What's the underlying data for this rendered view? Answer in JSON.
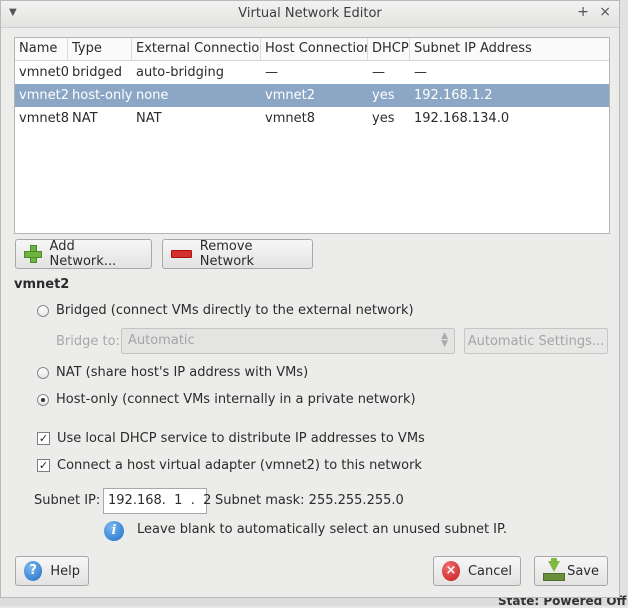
{
  "window": {
    "title": "Virtual Network Editor",
    "plus_glyph": "+",
    "close_glyph": "×",
    "menu_glyph": "▼"
  },
  "table": {
    "headers": [
      "Name",
      "Type",
      "External Connection",
      "Host Connection",
      "DHCP",
      "Subnet IP Address"
    ],
    "rows": [
      [
        "vmnet0",
        "bridged",
        "auto-bridging",
        "—",
        "—",
        "—"
      ],
      [
        "vmnet2",
        "host-only",
        "none",
        "vmnet2",
        "yes",
        "192.168.1.2"
      ],
      [
        "vmnet8",
        "NAT",
        "NAT",
        "vmnet8",
        "yes",
        "192.168.134.0"
      ]
    ],
    "selected_row": 1
  },
  "buttons": {
    "add_network": "Add Network...",
    "remove_network": "Remove Network",
    "help": "Help",
    "cancel": "Cancel",
    "save": "Save",
    "automatic_settings": "Automatic Settings..."
  },
  "section": {
    "title": "vmnet2",
    "bridged_label": "Bridged (connect VMs directly to the external network)",
    "bridge_to_label": "Bridge to:",
    "bridge_to_value": "Automatic",
    "nat_label": "NAT (share host's IP address with VMs)",
    "hostonly_label": "Host-only (connect VMs internally in a private network)",
    "dhcp_label": "Use local DHCP service to distribute IP addresses to VMs",
    "adapter_label": "Connect a host virtual adapter (vmnet2) to this network",
    "selected_mode": "host-only",
    "dhcp_checked": true,
    "adapter_checked": true
  },
  "subnet": {
    "ip_label": "Subnet IP:",
    "ip_value": "192.168.  1  .  2",
    "mask_label": "Subnet mask:",
    "mask_value": "255.255.255.0",
    "hint": "Leave blank to automatically select an unused subnet IP."
  },
  "background": {
    "status_text": "State: Powered Off"
  },
  "icons": {
    "help": "?",
    "cancel": "×",
    "info": "i",
    "check": "✓"
  }
}
